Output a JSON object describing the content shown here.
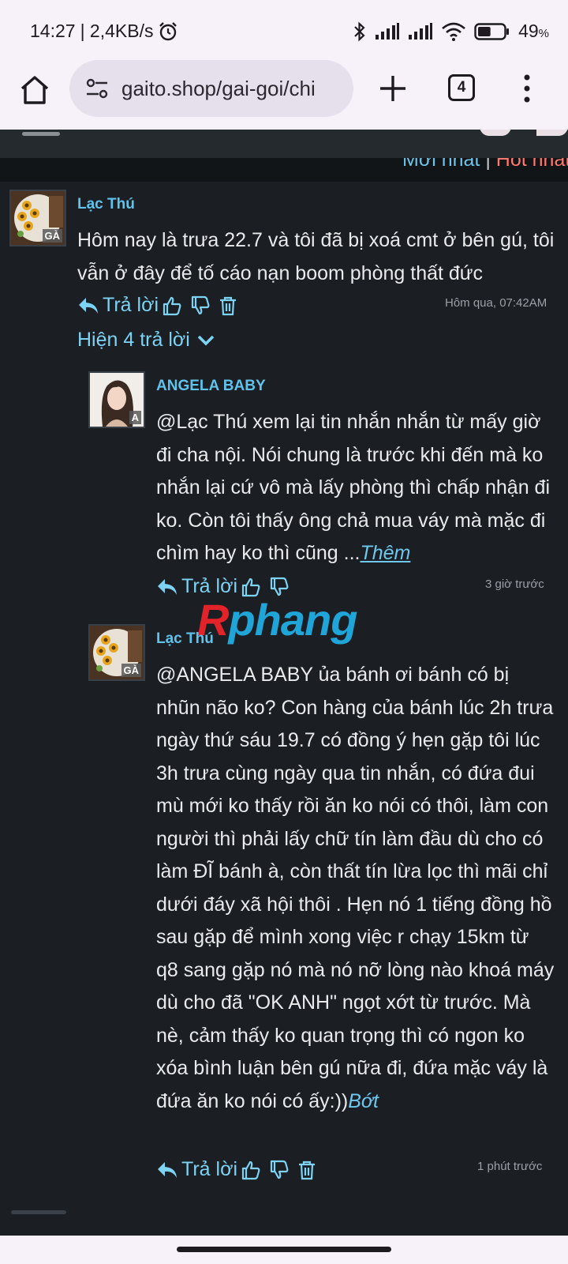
{
  "status": {
    "time": "14:27",
    "network_speed": "| 2,4KB/s",
    "battery": "49",
    "battery_unit": "%",
    "battery_level": 49
  },
  "browser": {
    "url": "gaito.shop/gai-goi/chi",
    "tab_count": "4"
  },
  "sort": {
    "newest": "Mới nhất",
    "separator": "|",
    "hot": "Hot nhất"
  },
  "comments": [
    {
      "author": "Lạc Thú",
      "badge": "GÀ",
      "text": "Hôm nay là trưa 22.7 và tôi đã bị xoá cmt ở bên gú, tôi vẫn ở đây để tố cáo nạn boom phòng thất đức",
      "reply_label": "Trả lời",
      "timestamp": "Hôm qua, 07:42AM",
      "show_replies": "Hiện 4 trả lời"
    },
    {
      "author": "ANGELA BABY",
      "badge": "A",
      "text": "@Lạc Thú xem lại tin nhắn nhắn từ mấy giờ đi cha nội. Nói chung là trước khi đến mà ko nhắn lại cứ vô mà lấy phòng thì chấp nhận đi ko. Còn tôi thấy ông chả mua váy mà mặc đi chìm hay ko thì cũng ...",
      "more_label": "Thêm",
      "reply_label": "Trả lời",
      "timestamp": "3 giờ trước"
    },
    {
      "author": "Lạc Thú",
      "badge": "GÀ",
      "text": "@ANGELA BABY ủa bánh ơi bánh có bị nhũn não ko? Con hàng của bánh lúc 2h trưa ngày thứ sáu 19.7 có đồng ý hẹn gặp tôi lúc 3h trưa cùng ngày qua tin nhắn, có đứa đui mù mới ko thấy rồi ăn ko nói có thôi, làm con người thì phải lấy chữ tín làm đầu dù cho có làm ĐĨ bánh à, còn thất tín lừa lọc thì mãi chỉ dưới đáy xã hội thôi . Hẹn nó 1 tiếng đồng hồ sau gặp để mình xong việc r chạy 15km từ q8 sang gặp nó mà nó nỡ lòng nào khoá máy dù cho đã \"OK ANH\" ngọt xớt từ trước. Mà nè, cảm thấy ko quan trọng thì có ngon ko xóa bình luận bên gú nữa đi, đứa mặc váy là đứa ăn ko nói có ấy:))",
      "less_label": "Bớt",
      "reply_label": "Trả lời",
      "timestamp": "1 phút trước"
    }
  ],
  "watermark": {
    "first": "R",
    "rest": "phang"
  },
  "colors": {
    "accent": "#7cd3f3",
    "author": "#5fc3ec",
    "hot": "#ff7a6e",
    "background": "#1b1f24"
  }
}
